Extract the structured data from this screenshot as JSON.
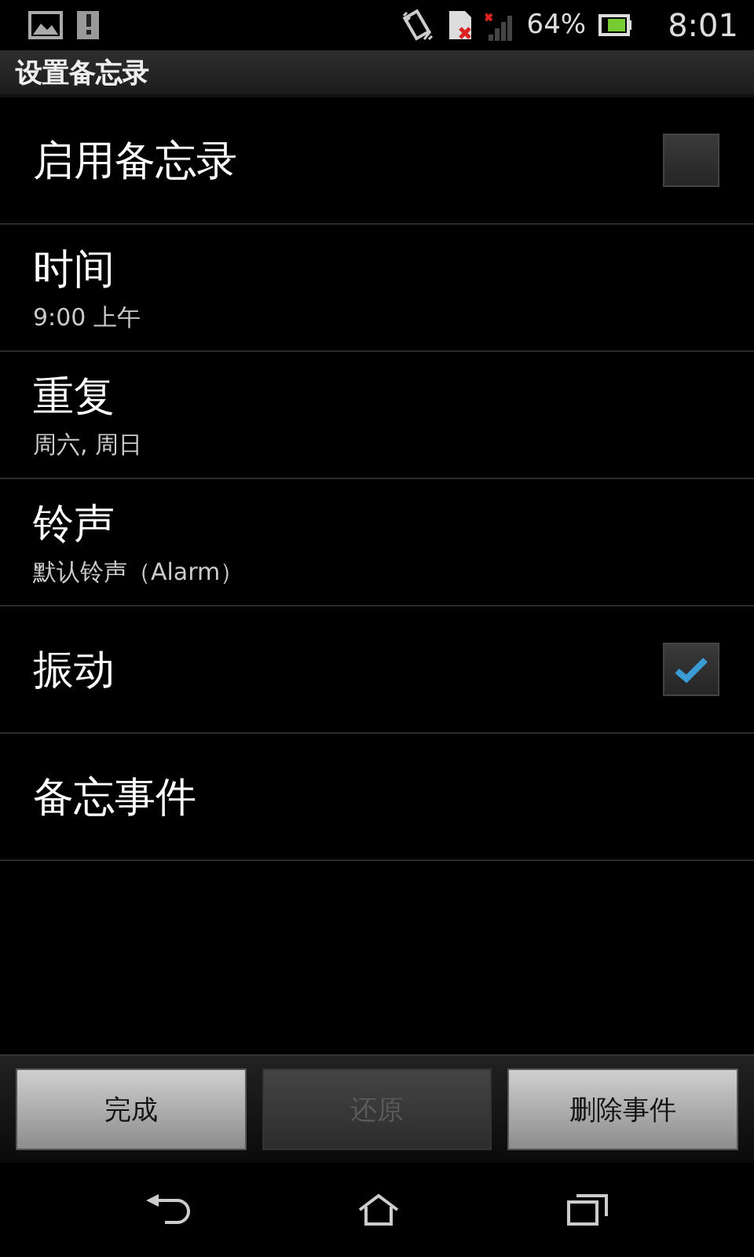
{
  "status_bar": {
    "battery_percent": "64%",
    "time": "8:01"
  },
  "title_bar": {
    "title": "设置备忘录"
  },
  "settings": [
    {
      "kind": "checkbox",
      "title": "启用备忘录",
      "checked": false
    },
    {
      "kind": "value",
      "title": "时间",
      "value": "9:00 上午"
    },
    {
      "kind": "value",
      "title": "重复",
      "value": "周六, 周日"
    },
    {
      "kind": "value",
      "title": "铃声",
      "value": "默认铃声（Alarm）"
    },
    {
      "kind": "checkbox",
      "title": "振动",
      "checked": true
    },
    {
      "kind": "plain",
      "title": "备忘事件"
    }
  ],
  "buttons": [
    {
      "label": "完成",
      "disabled": false
    },
    {
      "label": "还原",
      "disabled": true
    },
    {
      "label": "删除事件",
      "disabled": false
    }
  ]
}
